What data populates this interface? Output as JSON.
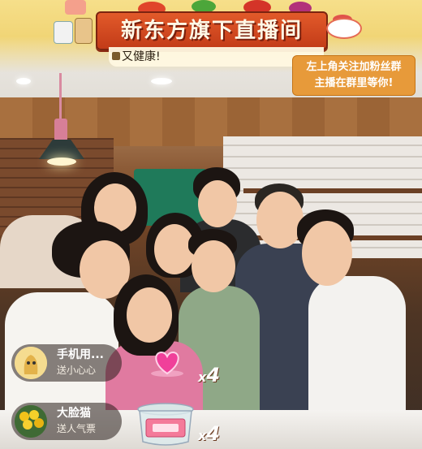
{
  "header": {
    "title": "新东方旗下直播间",
    "tagline": "又健康!",
    "notice_line1": "左上角关注加粉丝群",
    "notice_line2": "主播在群里等你!"
  },
  "gifts": [
    {
      "user": "手机用...",
      "action": "送小心心",
      "count_prefix": "x",
      "count": "4",
      "icon": "heart-icon"
    },
    {
      "user": "大脸猫",
      "action": "送人气票",
      "count_prefix": "x",
      "count": "4",
      "icon": "ticket-jar-icon"
    }
  ],
  "colors": {
    "banner": "#d24a20",
    "notice": "#e79a3a",
    "header_bg": "#f1d576"
  }
}
